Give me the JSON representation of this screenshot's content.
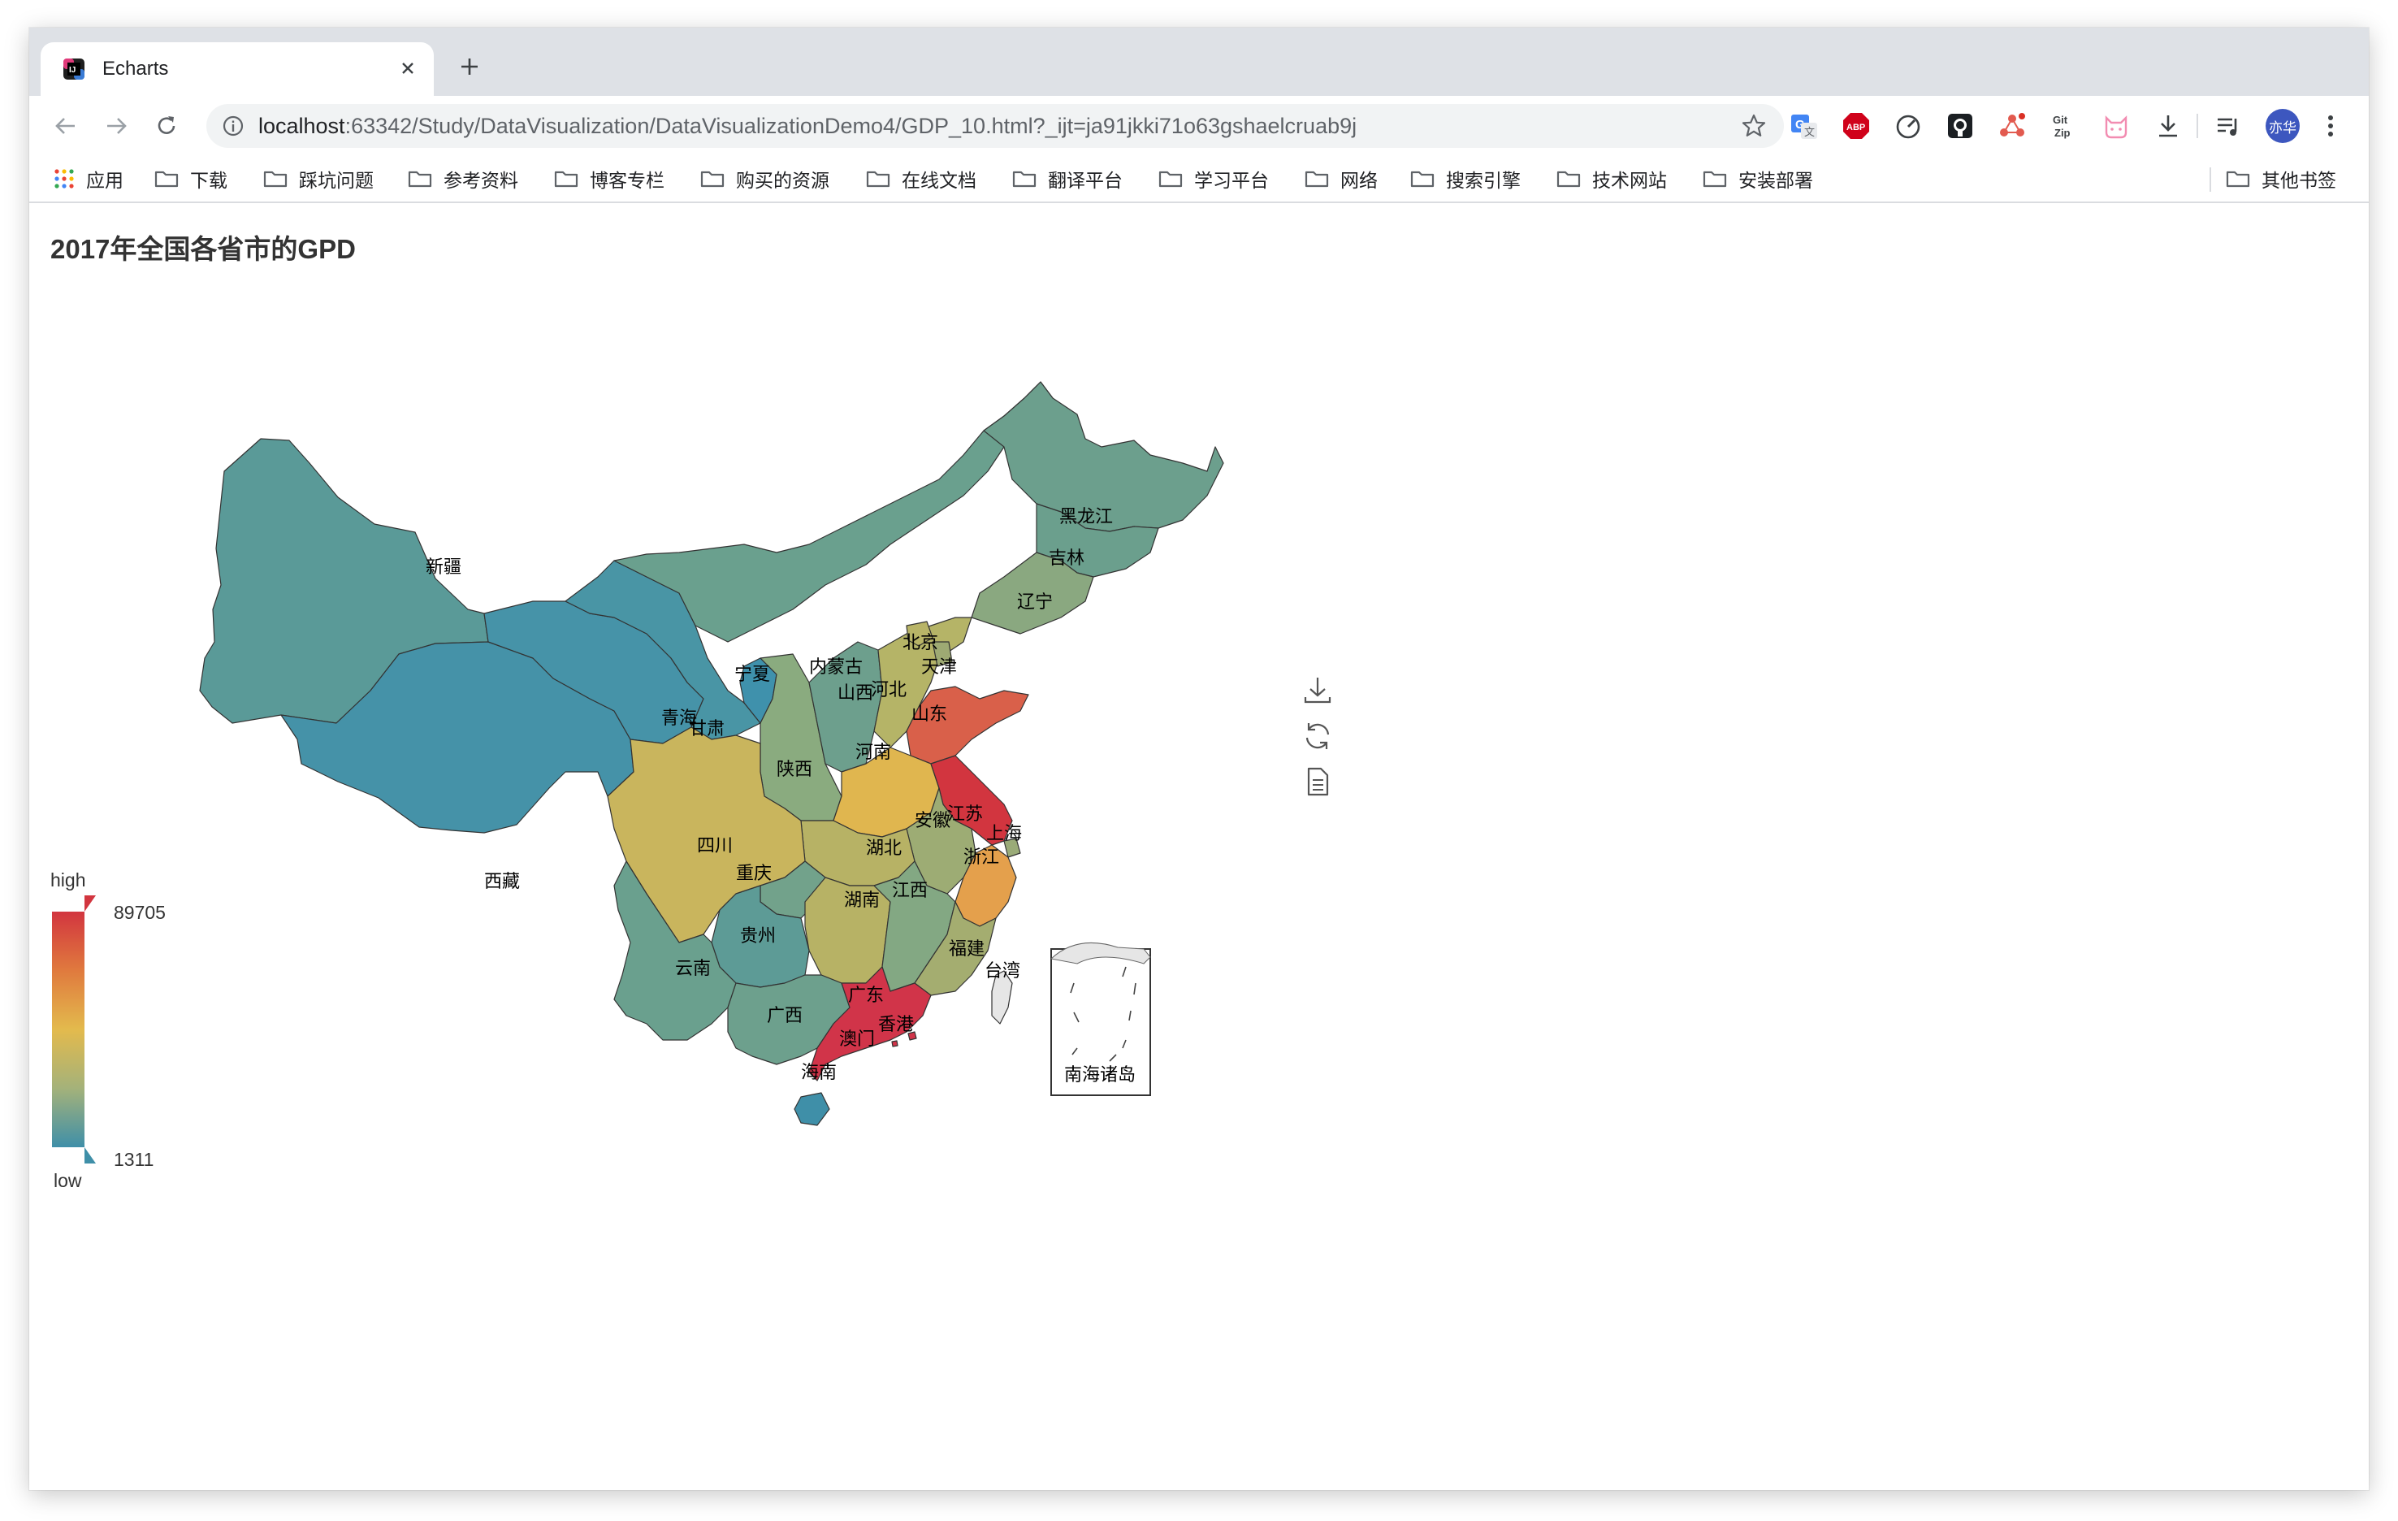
{
  "browser": {
    "tab_title": "Echarts",
    "url_host": "localhost",
    "url_rest": ":63342/Study/DataVisualization/DataVisualizationDemo4/GDP_10.html?_ijt=ja91jkki71o63gshaelcruab9j",
    "profile_label": "亦华",
    "extensions": [
      "translate-icon",
      "adblock-icon",
      "speed-icon",
      "github-icon",
      "network-icon",
      "git-zip-icon",
      "cat-icon",
      "download-icon",
      "media-icon"
    ]
  },
  "bookmarks": {
    "items": [
      {
        "label": "应用"
      },
      {
        "label": "下载"
      },
      {
        "label": "踩坑问题"
      },
      {
        "label": "参考资料"
      },
      {
        "label": "博客专栏"
      },
      {
        "label": "购买的资源"
      },
      {
        "label": "在线文档"
      },
      {
        "label": "翻译平台"
      },
      {
        "label": "学习平台"
      },
      {
        "label": "网络"
      },
      {
        "label": "搜索引擎"
      },
      {
        "label": "技术网站"
      },
      {
        "label": "安装部署"
      }
    ],
    "other": "其他书签"
  },
  "chart_data": {
    "type": "map",
    "title": "2017年全国各省市的GPD",
    "visual_map": {
      "max": 89705,
      "min": 1311,
      "high_text": "high",
      "low_text": "low",
      "colors": [
        "#3f8fa8",
        "#a4b27a",
        "#e3ba4d",
        "#e07a3e",
        "#d2353f"
      ]
    },
    "regions": [
      {
        "name": "新疆",
        "color": "#5a9a98"
      },
      {
        "name": "西藏",
        "color": "#4592a8"
      },
      {
        "name": "青海",
        "color": "#4693a8"
      },
      {
        "name": "甘肃",
        "color": "#4995a5"
      },
      {
        "name": "内蒙古",
        "color": "#6aa08e"
      },
      {
        "name": "黑龙江",
        "color": "#6c9f8d"
      },
      {
        "name": "吉林",
        "color": "#6b9f8d"
      },
      {
        "name": "辽宁",
        "color": "#8aa880"
      },
      {
        "name": "宁夏",
        "color": "#3f91ac"
      },
      {
        "name": "陕西",
        "color": "#8aab7f"
      },
      {
        "name": "山西",
        "color": "#6d9f8d"
      },
      {
        "name": "河北",
        "color": "#b5b467"
      },
      {
        "name": "北京",
        "color": "#b8b467"
      },
      {
        "name": "天津",
        "color": "#9eaa73"
      },
      {
        "name": "山东",
        "color": "#d9604a"
      },
      {
        "name": "河南",
        "color": "#e0b64f"
      },
      {
        "name": "江苏",
        "color": "#d2353f"
      },
      {
        "name": "上海",
        "color": "#9aab78"
      },
      {
        "name": "安徽",
        "color": "#9dac74"
      },
      {
        "name": "浙江",
        "color": "#e4a04c"
      },
      {
        "name": "湖北",
        "color": "#b7b265"
      },
      {
        "name": "四川",
        "color": "#c9b55d"
      },
      {
        "name": "重庆",
        "color": "#72a28b"
      },
      {
        "name": "湖南",
        "color": "#b7b265"
      },
      {
        "name": "江西",
        "color": "#83a883"
      },
      {
        "name": "福建",
        "color": "#a4ad70"
      },
      {
        "name": "贵州",
        "color": "#5d9b96"
      },
      {
        "name": "云南",
        "color": "#6aa08e"
      },
      {
        "name": "广西",
        "color": "#6da08d"
      },
      {
        "name": "广东",
        "color": "#d13449"
      },
      {
        "name": "海南",
        "color": "#3f8fa8"
      },
      {
        "name": "台湾",
        "color": "#e6e6e6"
      },
      {
        "name": "香港",
        "color": "#d13449"
      },
      {
        "name": "澳门",
        "color": "#d13449"
      }
    ],
    "inset_label": "南海诸岛"
  }
}
